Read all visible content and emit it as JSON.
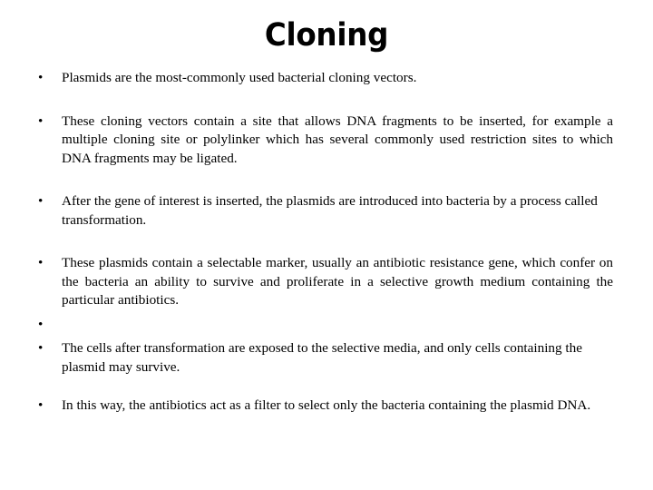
{
  "slide": {
    "title": "Cloning",
    "background_color": "#ffffff",
    "text_color": "#000000",
    "bullet_glyph": "•",
    "bullets": [
      {
        "marker": "•",
        "text": "Plasmids are the most-commonly used bacterial cloning vectors.",
        "align": "left"
      },
      {
        "marker": "•",
        "text": "These cloning vectors contain a site that allows DNA fragments to be inserted, for example a multiple cloning site or polylinker which has several commonly used restriction sites to which DNA fragments may be ligated.",
        "align": "justify"
      },
      {
        "marker": "•",
        "text": "After the gene of interest is inserted, the plasmids are introduced into bacteria by a process called transformation.",
        "align": "left"
      },
      {
        "marker": "•",
        "text": "These plasmids contain a selectable marker, usually an antibiotic resistance gene, which confer on the bacteria an ability to survive and proliferate in a selective growth medium containing the particular antibiotics.",
        "align": "justify"
      },
      {
        "marker": "•",
        "text": "",
        "align": "left"
      },
      {
        "marker": "•",
        "text": "The cells after transformation are exposed to the selective media, and only cells containing the plasmid may survive.",
        "align": "left"
      },
      {
        "marker": "•",
        "text": "In this way, the antibiotics act as a filter to select only the bacteria containing the plasmid DNA.",
        "align": "left"
      }
    ]
  }
}
